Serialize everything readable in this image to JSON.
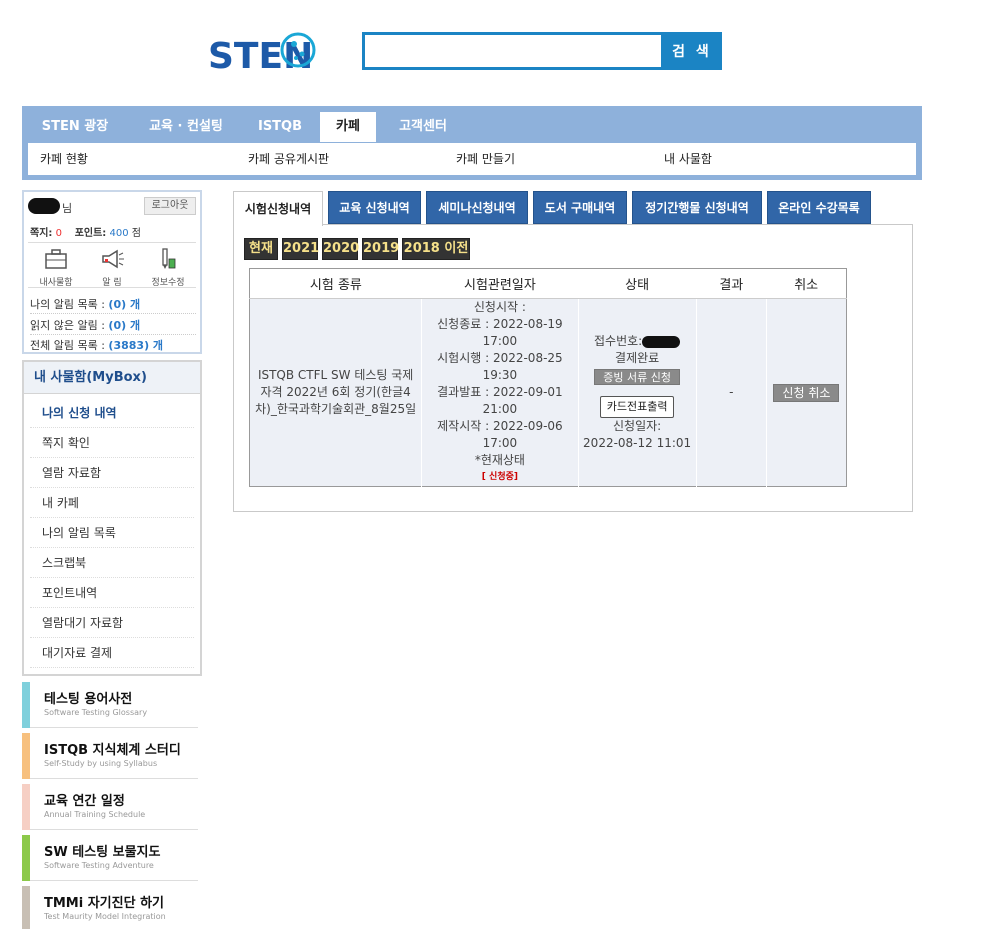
{
  "header": {
    "logo_text": "STEN",
    "search_placeholder": "",
    "search_button": "검 색"
  },
  "nav": {
    "tabs": [
      "STEN 광장",
      "교육 · 컨설팅",
      "ISTQB",
      "카페",
      "고객센터"
    ],
    "active_tab": "카페",
    "sub_items": [
      "카페 현황",
      "카페 공유게시판",
      "카페 만들기",
      "내 사물함"
    ]
  },
  "userbox": {
    "name_suffix": "님",
    "logout": "로그아웃",
    "note_label": "쪽지:",
    "note_count": "0",
    "point_label": "포인트:",
    "point_value": "400",
    "point_unit": "점",
    "icons": [
      {
        "label": "내사물함",
        "icon": "locker-icon"
      },
      {
        "label": "알 림",
        "icon": "megaphone-icon"
      },
      {
        "label": "정보수정",
        "icon": "pencil-icon"
      }
    ],
    "alerts": [
      {
        "label": "나의 알림 목록 :",
        "value": "(0) 개"
      },
      {
        "label": "읽지 않은 알림 :",
        "value": "(0) 개"
      },
      {
        "label": "전체 알림 목록 :",
        "value": "(3883) 개"
      }
    ]
  },
  "mybox": {
    "title": "내 사물함(MyBox)",
    "items": [
      "나의 신청 내역",
      "쪽지 확인",
      "열람 자료함",
      "내 카페",
      "나의 알림 목록",
      "스크랩북",
      "포인트내역",
      "열람대기 자료함",
      "대기자료 결제"
    ],
    "active_item": "나의 신청 내역"
  },
  "promos": [
    {
      "title": "테스팅 용어사전",
      "sub": "Software Testing Glossary",
      "color": "#7fd0dc"
    },
    {
      "title": "ISTQB 지식체계 스터디",
      "sub": "Self-Study by using Syllabus",
      "color": "#f7c07e"
    },
    {
      "title": "교육 연간 일정",
      "sub": "Annual Training Schedule",
      "color": "#f6cfc4"
    },
    {
      "title": "SW 테스팅 보물지도",
      "sub": "Software Testing Adventure",
      "color": "#8cc94a"
    },
    {
      "title": "TMMi 자기진단 하기",
      "sub": "Test Maurity Model Integration",
      "color": "#c8bfb4"
    }
  ],
  "content_tabs": [
    "시험신청내역",
    "교육 신청내역",
    "세미나신청내역",
    "도서 구매내역",
    "정기간행물 신청내역",
    "온라인 수강목록"
  ],
  "active_content_tab": "시험신청내역",
  "years": [
    "현재",
    "2021",
    "2020",
    "2019",
    "2018 이전"
  ],
  "table": {
    "headers": [
      "시험 종류",
      "시험관련일자",
      "상태",
      "결과",
      "취소"
    ],
    "row": {
      "exam_name": "ISTQB CTFL SW 테스팅 국제자격 2022년 6회 정기(한글4차)_한국과학기술회관_8월25일",
      "dates": [
        "신청시작 :",
        "신청종료 : 2022-08-19 17:00",
        "시험시행 : 2022-08-25 19:30",
        "결과발표 : 2022-09-01 21:00",
        "제작시작 : 2022-09-06 17:00",
        "*현재상태"
      ],
      "current_status": "[ 신청중]",
      "receipt_label": "접수번호:",
      "payment": "결제완료",
      "doc_button": "증빙 서류 신청",
      "print_button": "카드전표출력",
      "applied_label": "신청일자:",
      "applied_date": "2022-08-12 11:01",
      "result": "-",
      "cancel_button": "신청 취소"
    }
  }
}
